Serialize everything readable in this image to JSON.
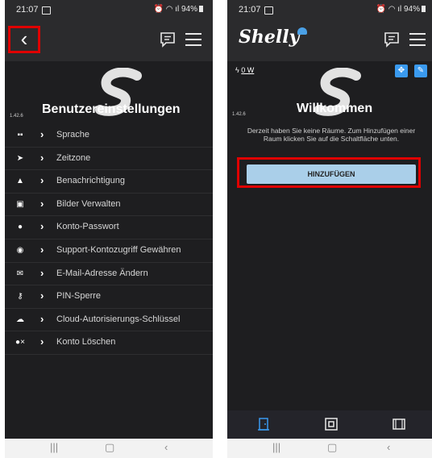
{
  "status": {
    "time": "21:07",
    "battery": "94%"
  },
  "left": {
    "version": "1.42.6",
    "title": "Benutzereinstellungen",
    "items": [
      {
        "label": "Sprache",
        "icon": "translate-icon"
      },
      {
        "label": "Zeitzone",
        "icon": "location-arrow-icon"
      },
      {
        "label": "Benachrichtigung",
        "icon": "bell-icon"
      },
      {
        "label": "Bilder Verwalten",
        "icon": "image-icon"
      },
      {
        "label": "Konto-Passwort",
        "icon": "user-icon"
      },
      {
        "label": "Support-Kontozugriff Gewähren",
        "icon": "support-icon"
      },
      {
        "label": "E-Mail-Adresse Ändern",
        "icon": "envelope-icon"
      },
      {
        "label": "PIN-Sperre",
        "icon": "key-icon"
      },
      {
        "label": "Cloud-Autorisierungs-Schlüssel",
        "icon": "cloud-icon"
      },
      {
        "label": "Konto Löschen",
        "icon": "user-remove-icon"
      }
    ]
  },
  "right": {
    "logo": "Shelly",
    "power": "0 W",
    "version": "1.42.6",
    "title": "Willkommen",
    "info": "Derzeit haben Sie keine Räume. Zum Hinzufügen einer Raum klicken Sie auf die Schaltfläche unten.",
    "add_button": "HINZUFÜGEN"
  },
  "colors": {
    "background": "#1e1e20",
    "bar": "#2b2b2d",
    "accent": "#3a9aef",
    "highlight": "#e00000",
    "button": "#aacfe9"
  }
}
